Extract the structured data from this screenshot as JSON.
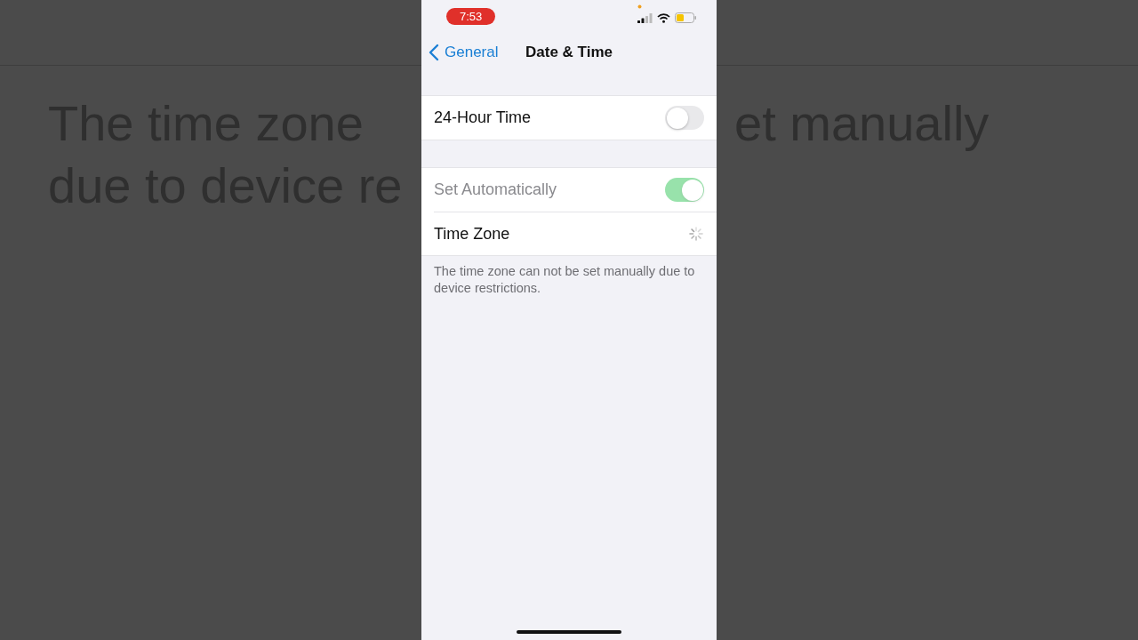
{
  "background": {
    "left_lines": [
      "The time zone",
      "due to device re"
    ],
    "right_lines": [
      "et manually"
    ]
  },
  "status_bar": {
    "time": "7:53"
  },
  "nav": {
    "back": "General",
    "title": "Date & Time"
  },
  "groups": [
    {
      "rows": [
        {
          "kind": "toggle",
          "label": "24-Hour Time",
          "on": false,
          "disabled": false
        }
      ]
    },
    {
      "rows": [
        {
          "kind": "toggle",
          "label": "Set Automatically",
          "on": true,
          "disabled": true
        },
        {
          "kind": "loading",
          "label": "Time Zone"
        }
      ],
      "footer": "The time zone can not be set manually due to device restrictions."
    }
  ]
}
